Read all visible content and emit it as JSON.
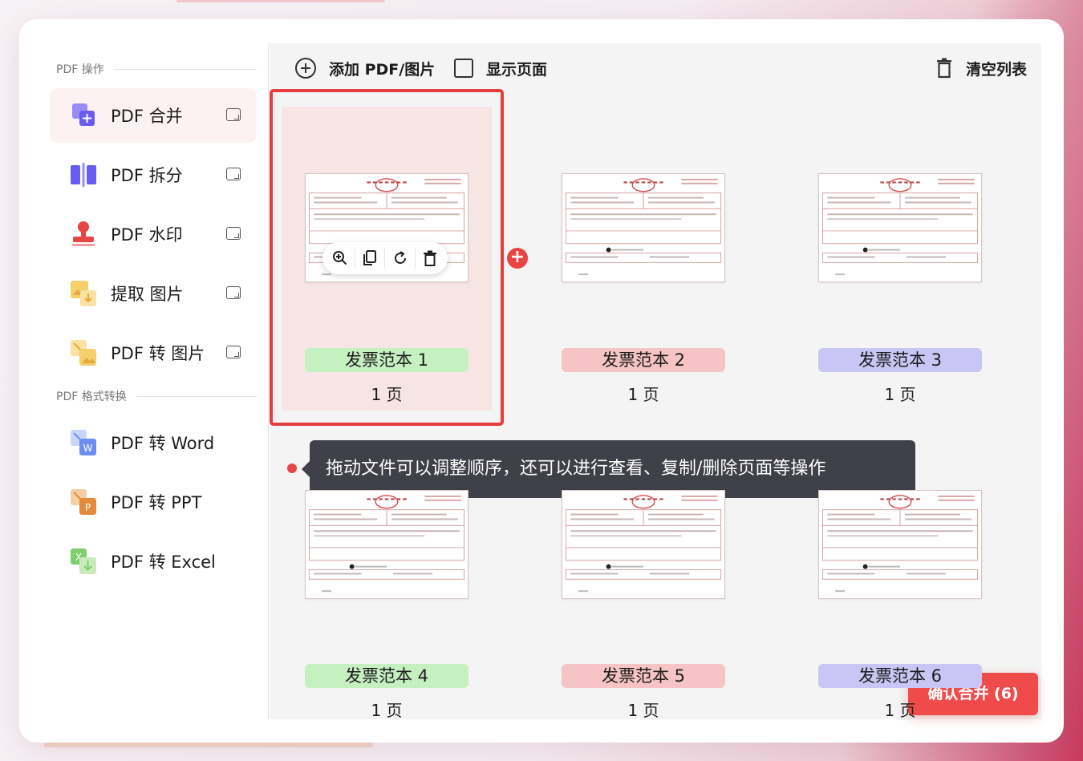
{
  "sidebar": {
    "section_operations": "PDF 操作",
    "section_conversion": "PDF 格式转换",
    "operations": [
      {
        "label": "PDF 合并",
        "icon": "merge-icon"
      },
      {
        "label": "PDF 拆分",
        "icon": "split-icon"
      },
      {
        "label": "PDF 水印",
        "icon": "stamp-icon"
      },
      {
        "label": "提取 图片",
        "icon": "extract-image-icon"
      },
      {
        "label": "PDF 转 图片",
        "icon": "image-convert-icon"
      }
    ],
    "conversions": [
      {
        "label": "PDF 转 Word",
        "icon": "word-icon",
        "badge": "W"
      },
      {
        "label": "PDF 转 PPT",
        "icon": "ppt-icon",
        "badge": "P"
      },
      {
        "label": "PDF 转 Excel",
        "icon": "excel-icon",
        "badge": "X"
      }
    ]
  },
  "toolbar": {
    "add_label": "添加 PDF/图片",
    "show_pages_label": "显示页面",
    "clear_label": "清空列表"
  },
  "files": [
    {
      "name": "发票范本 1",
      "pages": "1 页",
      "color": "#c5f0c0"
    },
    {
      "name": "发票范本 2",
      "pages": "1 页",
      "color": "#f6c4c4"
    },
    {
      "name": "发票范本 3",
      "pages": "1 页",
      "color": "#c9c6f5"
    },
    {
      "name": "发票范本 4",
      "pages": "1 页",
      "color": "#c5f0c0"
    },
    {
      "name": "发票范本 5",
      "pages": "1 页",
      "color": "#f6c4c4"
    },
    {
      "name": "发票范本 6",
      "pages": "1 页",
      "color": "#c9c6f5"
    }
  ],
  "tooltip": "拖动文件可以调整顺序，还可以进行查看、复制/删除页面等操作",
  "confirm_button": "确认合并 (6)",
  "colors": {
    "accent": "#ef4b4b",
    "selected_outline": "#e53e3e",
    "tooltip_bg": "#3f4048"
  }
}
